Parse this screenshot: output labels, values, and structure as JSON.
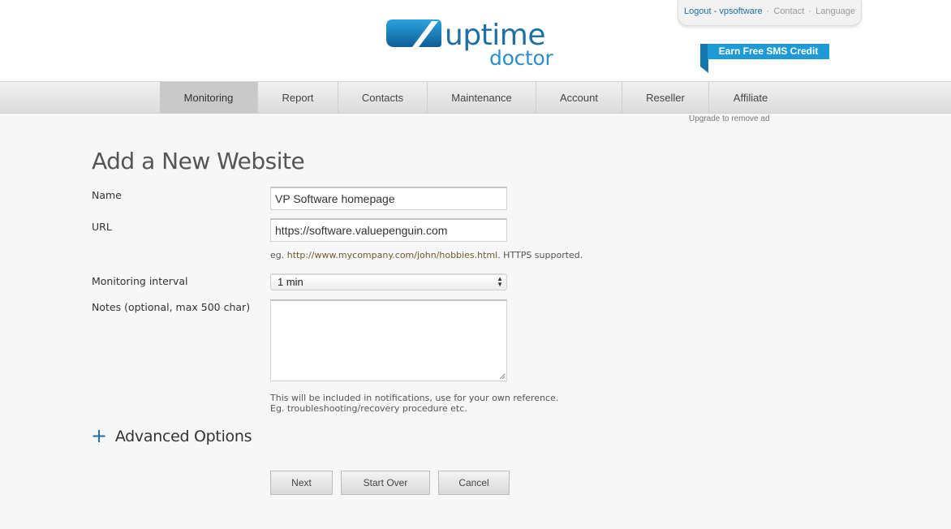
{
  "brand": {
    "word1": "uptime",
    "word2": "doctor"
  },
  "toplinks": {
    "logout": "Logout - vpsoftware",
    "contact": "Contact",
    "language": "Language",
    "separator": "·"
  },
  "promo": {
    "sms_credit": "Earn Free SMS Credit",
    "upgrade_ad": "Upgrade to remove ad"
  },
  "nav": {
    "items": [
      {
        "label": "Monitoring",
        "active": true
      },
      {
        "label": "Report",
        "active": false
      },
      {
        "label": "Contacts",
        "active": false
      },
      {
        "label": "Maintenance",
        "active": false
      },
      {
        "label": "Account",
        "active": false
      },
      {
        "label": "Reseller",
        "active": false
      },
      {
        "label": "Affiliate",
        "active": false
      }
    ]
  },
  "form": {
    "title": "Add a New Website",
    "name": {
      "label": "Name",
      "value": "VP Software homepage"
    },
    "url": {
      "label": "URL",
      "value": "https://software.valuepenguin.com",
      "hint_prefix": "eg.",
      "hint_url": "http://www.mycompany.com/john/hobbies.html",
      "hint_suffix": ". HTTPS supported."
    },
    "interval": {
      "label": "Monitoring interval",
      "value": "1 min"
    },
    "notes": {
      "label": "Notes (optional, max 500 char)",
      "value": "",
      "hint_line1": "This will be included in notifications, use for your own reference.",
      "hint_line2": "Eg. troubleshooting/recovery procedure etc."
    },
    "advanced": {
      "icon": "plus-icon",
      "label": "Advanced Options"
    },
    "buttons": {
      "next": "Next",
      "start_over": "Start Over",
      "cancel": "Cancel"
    }
  },
  "colors": {
    "brand_blue": "#1d6fa6",
    "promo_blue": "#1e9bd7",
    "page_bg": "#f7f7f7"
  }
}
